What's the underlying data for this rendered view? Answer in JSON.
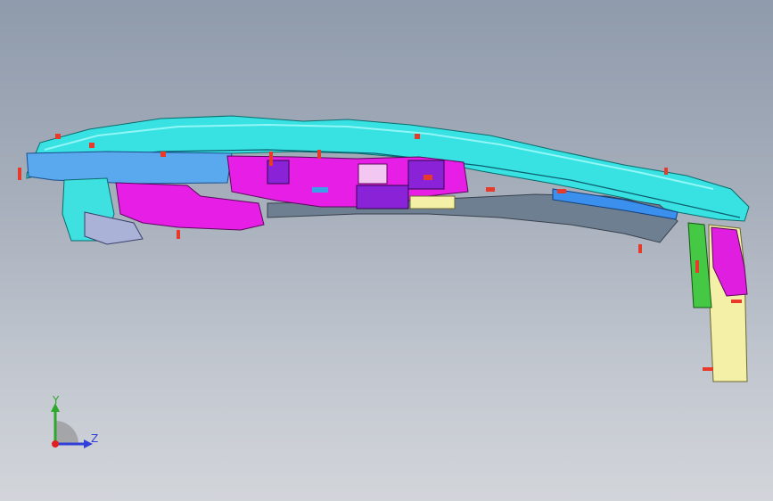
{
  "viewport": {
    "background_top": "#8f9aab",
    "background_bottom": "#d2d5da"
  },
  "model": {
    "colors": {
      "cyan": "#30e8e8",
      "magenta": "#e61ee6",
      "purple": "#8a20d8",
      "blue": "#4aa0f0",
      "gray": "#708090",
      "yellow": "#f4f0a0",
      "green": "#3fc13f",
      "fastener": "#e83a2a"
    }
  },
  "triad": {
    "y_label": "Y",
    "z_label": "Z",
    "y_color": "#2da82d",
    "z_color": "#2f3fd8",
    "x_color": "#e02020"
  }
}
